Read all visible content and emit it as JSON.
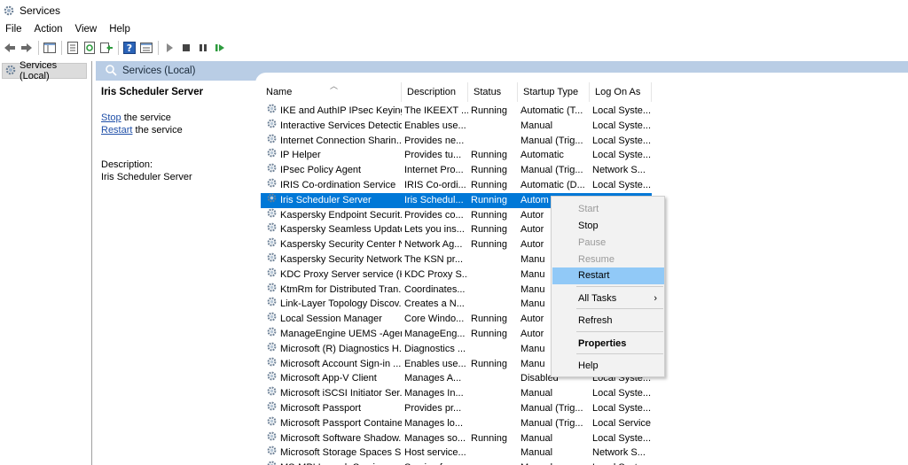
{
  "window": {
    "title": "Services"
  },
  "menu": [
    "File",
    "Action",
    "View",
    "Help"
  ],
  "toolbar": {
    "icons": [
      "back-arrow-icon",
      "forward-arrow-icon",
      "console-tree-icon",
      "properties-icon",
      "refresh-icon",
      "export-list-icon",
      "help-icon",
      "view-icon",
      "start-service-icon",
      "stop-service-icon",
      "pause-service-icon",
      "restart-service-icon"
    ]
  },
  "tree": {
    "root": "Services (Local)"
  },
  "pane_header": {
    "title": "Services (Local)"
  },
  "details": {
    "service_name": "Iris Scheduler Server",
    "stop_link": "Stop",
    "stop_rest": " the service",
    "restart_link": "Restart",
    "restart_rest": " the service",
    "description_label": "Description:",
    "description_text": "Iris Scheduler Server"
  },
  "columns": {
    "name": "Name",
    "description": "Description",
    "status": "Status",
    "startup": "Startup Type",
    "logon": "Log On As"
  },
  "services": [
    {
      "name": "IKE and AuthIP IPsec Keying...",
      "description": "The IKEEXT ...",
      "status": "Running",
      "startup": "Automatic (T...",
      "logon": "Local Syste..."
    },
    {
      "name": "Interactive Services Detection",
      "description": "Enables use...",
      "status": "",
      "startup": "Manual",
      "logon": "Local Syste..."
    },
    {
      "name": "Internet Connection Sharin...",
      "description": "Provides ne...",
      "status": "",
      "startup": "Manual (Trig...",
      "logon": "Local Syste..."
    },
    {
      "name": "IP Helper",
      "description": "Provides tu...",
      "status": "Running",
      "startup": "Automatic",
      "logon": "Local Syste..."
    },
    {
      "name": "IPsec Policy Agent",
      "description": "Internet Pro...",
      "status": "Running",
      "startup": "Manual (Trig...",
      "logon": "Network S..."
    },
    {
      "name": "IRIS Co-ordination Service",
      "description": "IRIS Co-ordi...",
      "status": "Running",
      "startup": "Automatic (D...",
      "logon": "Local Syste..."
    },
    {
      "name": "Iris Scheduler Server",
      "description": "Iris Schedul...",
      "status": "Running",
      "startup": "Autom",
      "logon": "",
      "selected": true
    },
    {
      "name": "Kaspersky Endpoint Securit...",
      "description": "Provides co...",
      "status": "Running",
      "startup": "Autor",
      "logon": ""
    },
    {
      "name": "Kaspersky Seamless Update ...",
      "description": "Lets you ins...",
      "status": "Running",
      "startup": "Autor",
      "logon": ""
    },
    {
      "name": "Kaspersky Security Center N...",
      "description": "Network Ag...",
      "status": "Running",
      "startup": "Autor",
      "logon": ""
    },
    {
      "name": "Kaspersky Security Network...",
      "description": "The KSN pr...",
      "status": "",
      "startup": "Manu",
      "logon": ""
    },
    {
      "name": "KDC Proxy Server service (K...",
      "description": "KDC Proxy S...",
      "status": "",
      "startup": "Manu",
      "logon": ""
    },
    {
      "name": "KtmRm for Distributed Tran...",
      "description": "Coordinates...",
      "status": "",
      "startup": "Manu",
      "logon": ""
    },
    {
      "name": "Link-Layer Topology Discov...",
      "description": "Creates a N...",
      "status": "",
      "startup": "Manu",
      "logon": ""
    },
    {
      "name": "Local Session Manager",
      "description": "Core Windo...",
      "status": "Running",
      "startup": "Autor",
      "logon": ""
    },
    {
      "name": "ManageEngine UEMS -Agent",
      "description": "ManageEng...",
      "status": "Running",
      "startup": "Autor",
      "logon": ""
    },
    {
      "name": "Microsoft (R) Diagnostics H...",
      "description": "Diagnostics ...",
      "status": "",
      "startup": "Manu",
      "logon": ""
    },
    {
      "name": "Microsoft Account Sign-in ...",
      "description": "Enables use...",
      "status": "Running",
      "startup": "Manu",
      "logon": ""
    },
    {
      "name": "Microsoft App-V Client",
      "description": "Manages A...",
      "status": "",
      "startup": "Disabled",
      "logon": "Local Syste..."
    },
    {
      "name": "Microsoft iSCSI Initiator Ser...",
      "description": "Manages In...",
      "status": "",
      "startup": "Manual",
      "logon": "Local Syste..."
    },
    {
      "name": "Microsoft Passport",
      "description": "Provides pr...",
      "status": "",
      "startup": "Manual (Trig...",
      "logon": "Local Syste..."
    },
    {
      "name": "Microsoft Passport Container",
      "description": "Manages lo...",
      "status": "",
      "startup": "Manual (Trig...",
      "logon": "Local Service"
    },
    {
      "name": "Microsoft Software Shadow...",
      "description": "Manages so...",
      "status": "Running",
      "startup": "Manual",
      "logon": "Local Syste..."
    },
    {
      "name": "Microsoft Storage Spaces S...",
      "description": "Host service...",
      "status": "",
      "startup": "Manual",
      "logon": "Network S..."
    },
    {
      "name": "MS-MPI Launch Service",
      "description": "Service for...",
      "status": "",
      "startup": "Manual",
      "logon": "Local Syste..."
    }
  ],
  "context_menu": {
    "items": [
      {
        "label": "Start",
        "state": "disabled"
      },
      {
        "label": "Stop",
        "state": "enabled"
      },
      {
        "label": "Pause",
        "state": "disabled"
      },
      {
        "label": "Resume",
        "state": "disabled"
      },
      {
        "label": "Restart",
        "state": "highlighted"
      },
      {
        "label": "All Tasks",
        "state": "submenu"
      },
      {
        "label": "Refresh",
        "state": "enabled"
      },
      {
        "label": "Properties",
        "state": "bold"
      },
      {
        "label": "Help",
        "state": "enabled"
      }
    ],
    "submenu_arrow": "›"
  },
  "colors": {
    "selection": "#0078d7",
    "menu_highlight": "#91c9f7",
    "header": "#b9cde5",
    "link": "#1f4fa8"
  }
}
